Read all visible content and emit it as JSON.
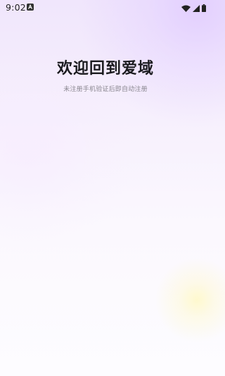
{
  "status_bar": {
    "time": "9:02",
    "notification_icon": "a-badge-icon",
    "wifi_icon": "wifi-icon",
    "signal_icon": "signal-icon",
    "battery_icon": "battery-icon"
  },
  "header": {
    "title": "欢迎回到爱域",
    "subtitle": "未注册手机验证后即自动注册"
  },
  "colors": {
    "background_top": "#f0e6fc",
    "background_bottom": "#fdfcff",
    "title": "#1b1b1f",
    "subtitle": "#8a8790",
    "accent_glow": "#fff8be"
  }
}
